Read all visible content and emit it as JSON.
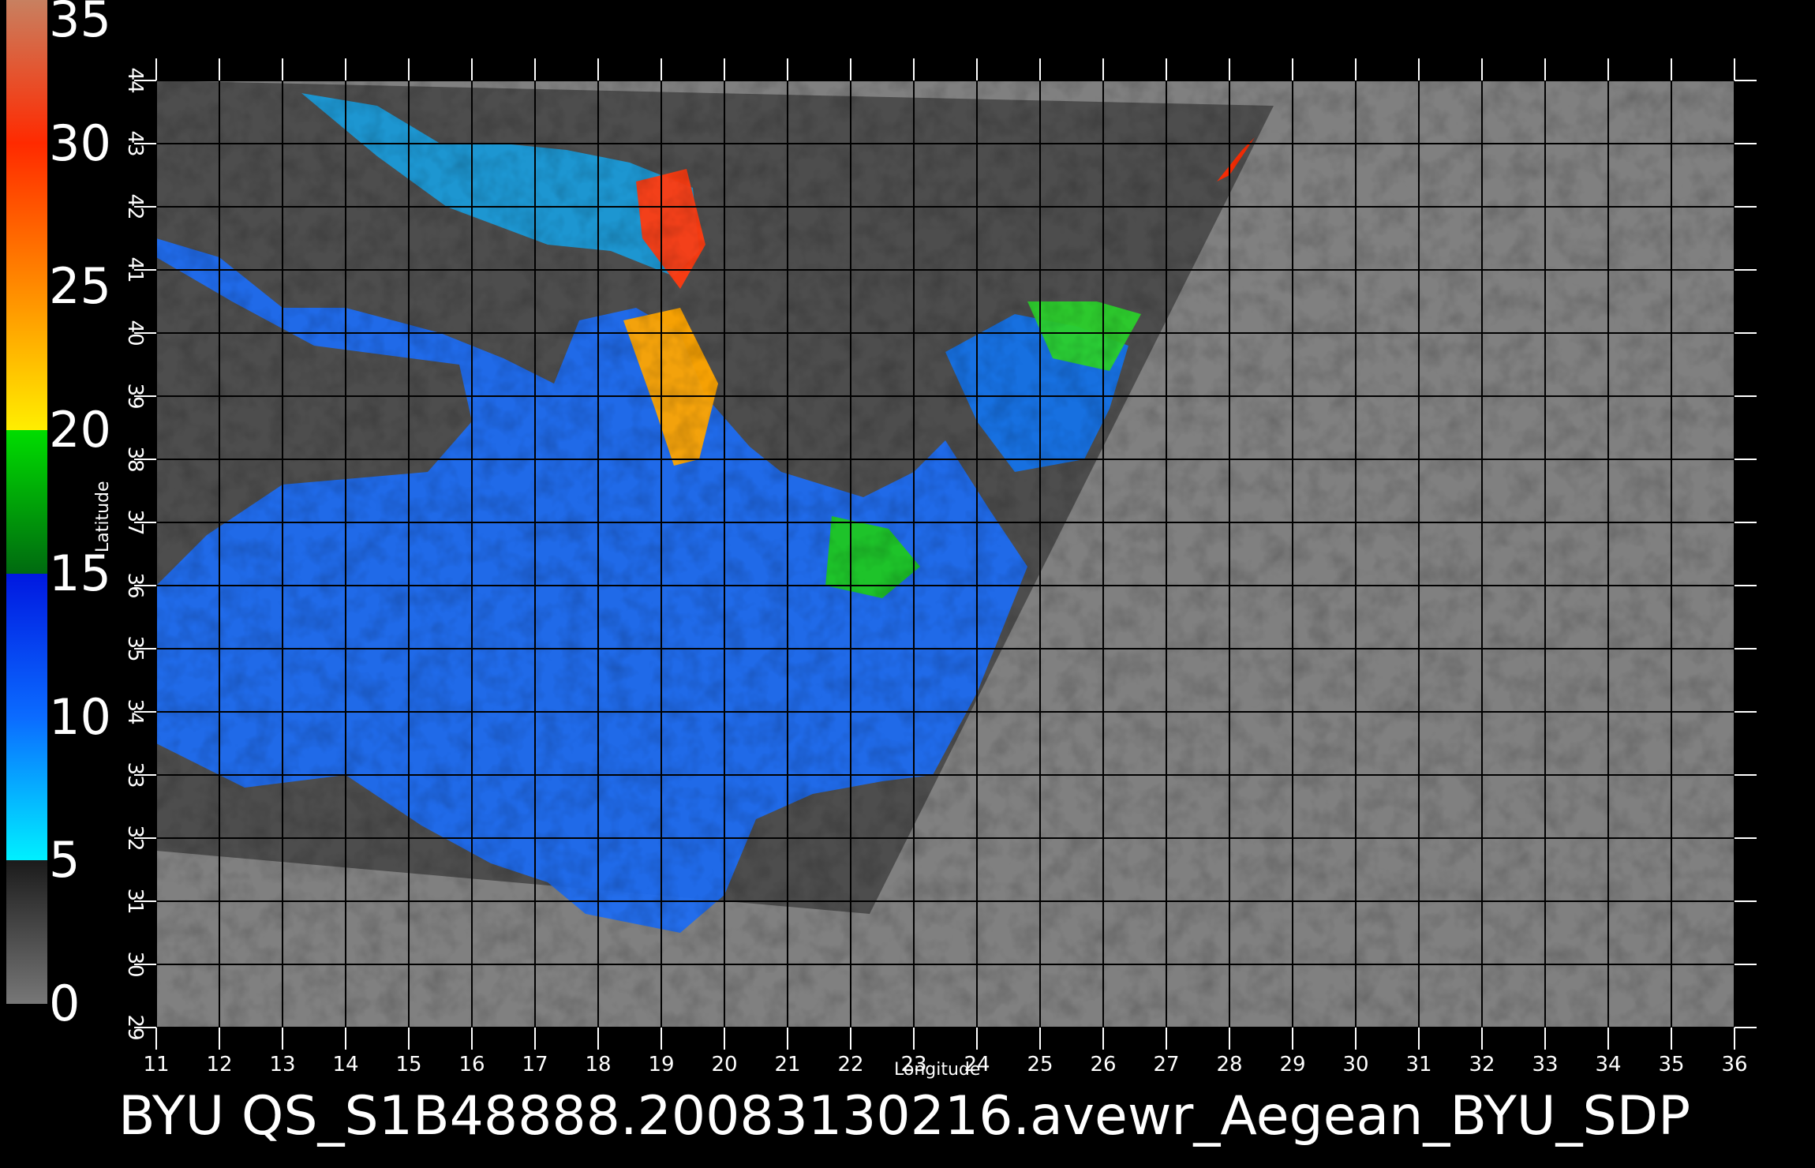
{
  "colorbar": {
    "labels": [
      "35",
      "30",
      "25",
      "20",
      "15",
      "10",
      "5",
      "0"
    ],
    "stops": [
      {
        "value": 0,
        "color": "#777777"
      },
      {
        "value": 5,
        "color": "#1b1b1b"
      },
      {
        "value": 5,
        "color": "#00f0ff"
      },
      {
        "value": 10,
        "color": "#0b6bff"
      },
      {
        "value": 15,
        "color": "#0018e0"
      },
      {
        "value": 15,
        "color": "#006a10"
      },
      {
        "value": 20,
        "color": "#00dd00"
      },
      {
        "value": 20,
        "color": "#ffee00"
      },
      {
        "value": 25,
        "color": "#ff8a00"
      },
      {
        "value": 30,
        "color": "#ff2a00"
      },
      {
        "value": 35,
        "color": "#c88060"
      }
    ]
  },
  "map": {
    "xlabel": "Longitude",
    "ylabel": "Latitude",
    "lon_range": [
      11,
      36
    ],
    "lat_range": [
      29,
      44
    ],
    "lon_ticks": [
      "11",
      "12",
      "13",
      "14",
      "15",
      "16",
      "17",
      "18",
      "19",
      "20",
      "21",
      "22",
      "23",
      "24",
      "25",
      "26",
      "27",
      "28",
      "29",
      "30",
      "31",
      "32",
      "33",
      "34",
      "35",
      "36"
    ],
    "lat_ticks": [
      "29",
      "30",
      "31",
      "32",
      "33",
      "34",
      "35",
      "36",
      "37",
      "38",
      "39",
      "40",
      "41",
      "42",
      "43",
      "44"
    ],
    "colors": {
      "background": "#000000",
      "no_data": "#808080",
      "land": "#4d4d4d",
      "sea": "#1e6cf0",
      "grid": "#000000"
    },
    "swath_lonlat": [
      [
        11,
        44
      ],
      [
        28.7,
        43.6
      ],
      [
        22.3,
        30.8
      ],
      [
        11,
        31.8
      ]
    ]
  },
  "footer": {
    "text": "BYU  QS_S1B48888.20083130216.avewr_Aegean_BYU_SDP"
  }
}
